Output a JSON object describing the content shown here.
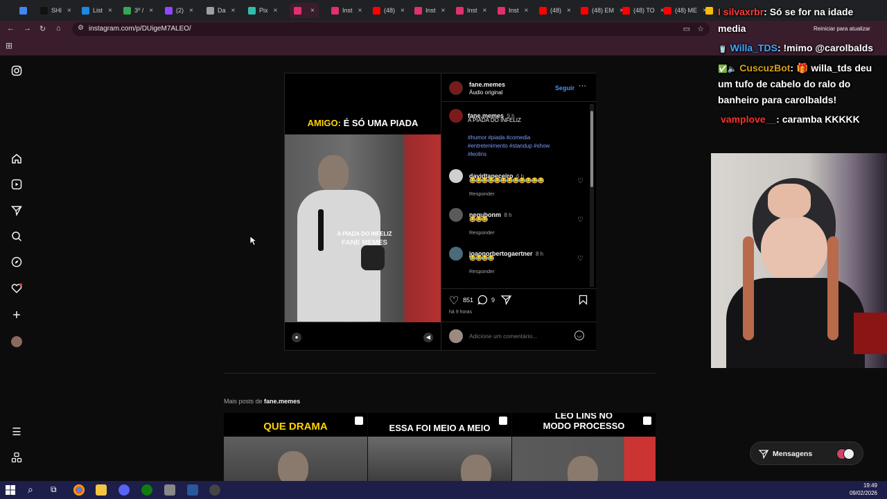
{
  "browser": {
    "tabs": [
      {
        "label": "",
        "color": "#4285f4"
      },
      {
        "label": "SHI",
        "color": "#111111"
      },
      {
        "label": "List",
        "color": "#1e88e5"
      },
      {
        "label": "3º /",
        "color": "#34a853"
      },
      {
        "label": "(2)",
        "color": "#9146ff"
      },
      {
        "label": "Da",
        "color": "#9aa0a6"
      },
      {
        "label": "Pix",
        "color": "#32bcad"
      },
      {
        "label": "",
        "color": "#e1306c"
      },
      {
        "label": "Inst",
        "color": "#e1306c"
      },
      {
        "label": "(48)",
        "color": "#ff0000"
      },
      {
        "label": "Inst",
        "color": "#e1306c"
      },
      {
        "label": "Inst",
        "color": "#e1306c"
      },
      {
        "label": "Inst",
        "color": "#e1306c"
      },
      {
        "label": "(48)",
        "color": "#ff0000"
      },
      {
        "label": "(48) EM",
        "color": "#ff0000"
      },
      {
        "label": "(48) TO",
        "color": "#ff0000"
      },
      {
        "label": "(48) ME",
        "color": "#ff0000"
      },
      {
        "label": "",
        "color": "#fbbc04"
      }
    ],
    "url": "instagram.com/p/DUigeM7ALEO/",
    "restart_label": "Reiniciar para atualizar"
  },
  "sidebar": {
    "icons": [
      "instagram-logo-icon",
      "home-icon",
      "reels-icon",
      "messages-icon",
      "search-icon",
      "explore-icon",
      "notifications-icon",
      "create-icon",
      "profile-avatar",
      "menu-icon",
      "more-icon"
    ]
  },
  "video": {
    "caption_highlight": "AMIGO:",
    "caption_rest": "É SÓ UMA PIADA",
    "overlay_line1": "A PIADA DO INFELIZ",
    "overlay_line2": "FANE MEMES"
  },
  "post": {
    "author": "fane.memes",
    "audio": "Áudio original",
    "follow_label": "Seguir",
    "caption": {
      "user": "fane.memes",
      "time": "9 h",
      "text": "A PIADA DO INFELIZ",
      "tags_line1": "#humor #piada #comedia",
      "tags_line2": "#entretenimento #standup #show",
      "tags_line3": "#leolins"
    },
    "comments": [
      {
        "user": "davidtapeceiro",
        "time": "6 h",
        "text": "😂😂😂😂😂😂😂😂😂😂😂😂",
        "reply": "Responder"
      },
      {
        "user": "negubonm",
        "time": "8 h",
        "text": "😂😂😂",
        "reply": "Responder"
      },
      {
        "user": "joaonorbertogaertner",
        "time": "8 h",
        "text": "😂😂😂😂",
        "reply": "Responder"
      }
    ],
    "likes": "851",
    "comment_count": "9",
    "posted": "há 9 horas",
    "add_comment_placeholder": "Adicione um comentário..."
  },
  "more_posts": {
    "label_prefix": "Mais posts de",
    "label_user": "fane.memes",
    "items": [
      {
        "caption": "QUE DRAMA"
      },
      {
        "caption": "ESSA FOI MEIO A MEIO"
      },
      {
        "caption_line1": "LEO LINS NO",
        "caption_line2": "MODO PROCESSO"
      }
    ]
  },
  "messages": {
    "label": "Mensagens"
  },
  "chat": [
    {
      "user": "I silvaxrbr",
      "user_color": "#ff3b3b",
      "text": "Só se for na idade"
    },
    {
      "user": "",
      "user_color": "#ffffff",
      "text": "media"
    },
    {
      "user": "Willa_TDS",
      "user_color": "#3fa9ff",
      "text": "!mimo @carolbalds"
    },
    {
      "user": "CuscuzBot",
      "user_color": "#d4a017",
      "text": "willa_tds deu"
    },
    {
      "user": "",
      "user_color": "#ffffff",
      "text": "um tufo de cabelo do ralo do"
    },
    {
      "user": "",
      "user_color": "#ffffff",
      "text": "banheiro para carolbalds!"
    },
    {
      "user": "vamplove__",
      "user_color": "#ff3030",
      "text": "caramba KKKKK"
    }
  ],
  "taskbar": {
    "time": "19:49",
    "date": "09/02/2026"
  }
}
